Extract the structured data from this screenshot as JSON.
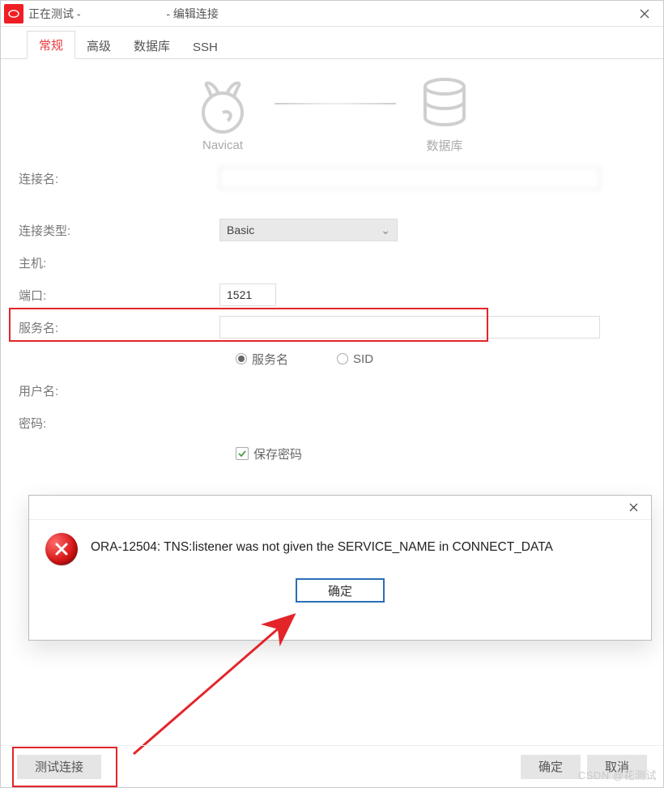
{
  "titlebar": {
    "testing_prefix": "正在测试 - ",
    "suffix": " - 编辑连接"
  },
  "tabs": {
    "items": [
      {
        "label": "常规",
        "active": true
      },
      {
        "label": "高级",
        "active": false
      },
      {
        "label": "数据库",
        "active": false
      },
      {
        "label": "SSH",
        "active": false
      }
    ]
  },
  "diagram": {
    "left_caption": "Navicat",
    "right_caption": "数据库"
  },
  "form": {
    "connection_name_label": "连接名:",
    "connection_name_value": "",
    "connection_type_label": "连接类型:",
    "connection_type_value": "Basic",
    "host_label": "主机:",
    "host_value": "",
    "port_label": "端口:",
    "port_value": "1521",
    "service_name_label": "服务名:",
    "service_name_value": "",
    "radio_service_label": "服务名",
    "radio_sid_label": "SID",
    "radio_selected": "service",
    "username_label": "用户名:",
    "username_value": "",
    "password_label": "密码:",
    "password_value": "",
    "save_password_label": "保存密码",
    "save_password_checked": true
  },
  "msgbox": {
    "text": "ORA-12504: TNS:listener was not given the SERVICE_NAME in CONNECT_DATA",
    "ok_label": "确定"
  },
  "buttonbar": {
    "test_label": "测试连接",
    "ok_label": "确定",
    "cancel_label": "取消"
  },
  "watermark": "CSDN @花测试"
}
